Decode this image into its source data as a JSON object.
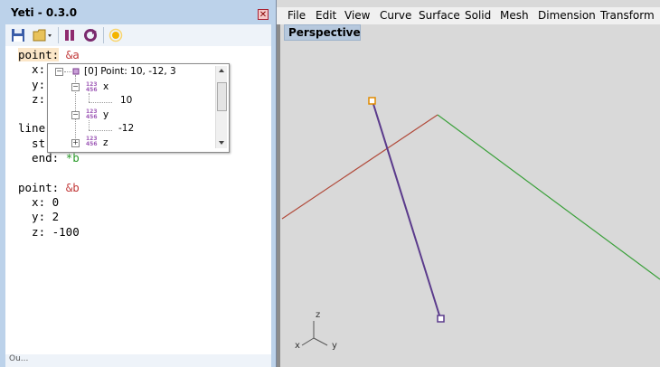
{
  "yeti": {
    "title": "Yeti - 0.3.0",
    "close_glyph": "✕",
    "toolbar": {
      "icons": [
        "save-icon",
        "open-folder-icon",
        "pause-icon",
        "refresh-icon",
        "sun-icon"
      ]
    },
    "code_lines": {
      "l1_key": "point:",
      "l1_anchor": "&a",
      "l2": "  x:",
      "l3": "  y:",
      "l4": "  z:",
      "l6": "line",
      "l7": "  st",
      "l8_key": "  end:",
      "l8_alias": "*b",
      "l10_key": "point:",
      "l10_anchor": "&b",
      "l11": "  x: 0",
      "l12": "  y: 2",
      "l13": "  z: -100"
    },
    "popup": {
      "root_label": "[0] Point: 10, -12, 3",
      "x_label": "x",
      "x_value": "10",
      "y_label": "y",
      "y_value": "-12",
      "z_label": "z",
      "num_icon_top": "123",
      "num_icon_bottom": "456"
    },
    "status_text": "Ou..."
  },
  "rhino": {
    "menu": [
      "File",
      "Edit",
      "View",
      "Curve",
      "Surface",
      "Solid",
      "Mesh",
      "Dimension",
      "Transform"
    ],
    "viewport_tab": "Perspective",
    "axes": {
      "z": "z",
      "x": "x",
      "y": "y"
    }
  }
}
